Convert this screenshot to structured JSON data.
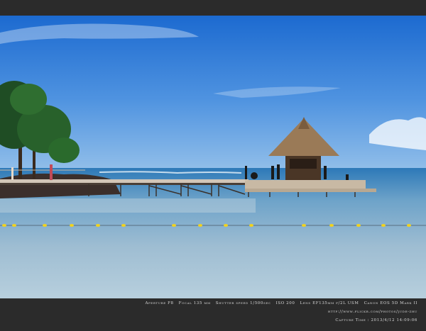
{
  "exif": {
    "aperture": "Aperture F8",
    "focal": "Focal 135 mm",
    "shutter": "Shutter speed 1/500sec",
    "iso": "ISO 200",
    "lens": "Lens EF135mm f/2L USM",
    "camera": "Canon EOS 5D Mark II",
    "url": "http://www.flickr.com/photos/jude-zhu",
    "capture": "Capture Time : 2013/4/12 14:09:06"
  },
  "colors": {
    "sky_top": "#1e6fd0",
    "sky_bottom": "#7fb4e8",
    "sea_deep": "#2e6fa8",
    "sea_near": "#a9c4d6",
    "border": "#2b2b2b"
  }
}
